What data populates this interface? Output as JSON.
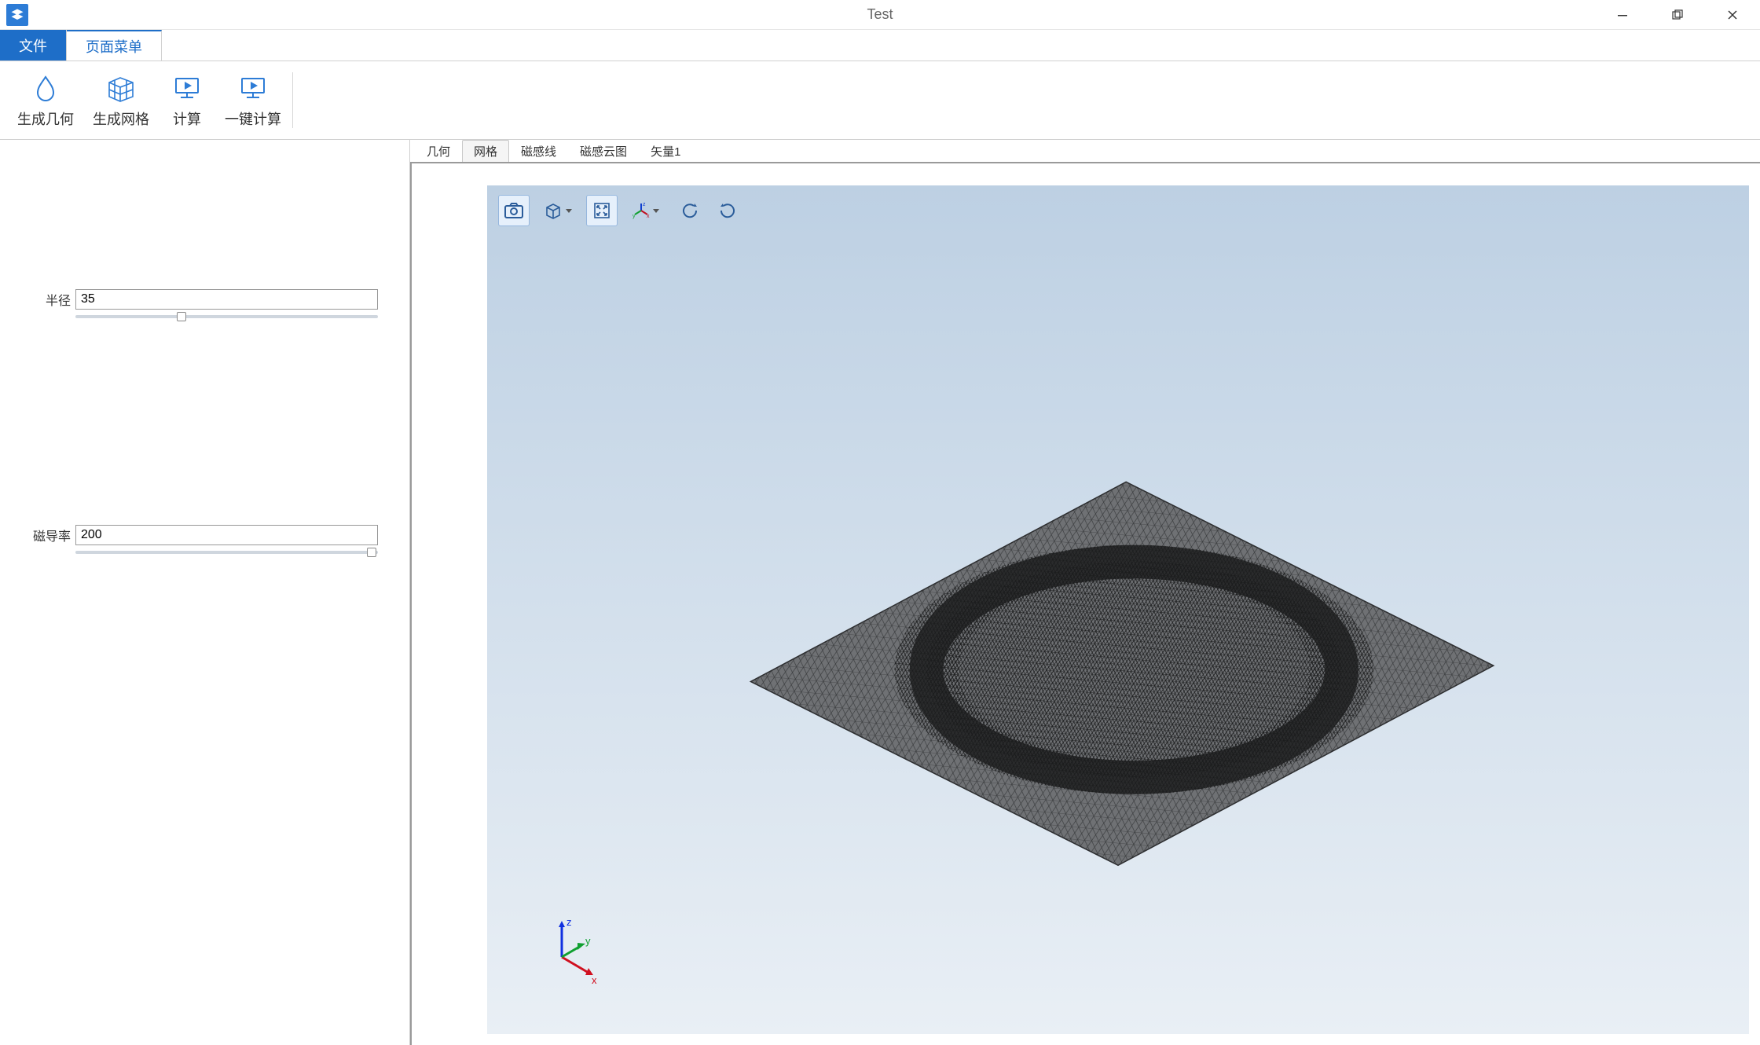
{
  "window": {
    "title": "Test"
  },
  "ribbonTabs": {
    "file": "文件",
    "page": "页面菜单"
  },
  "ribbonButtons": {
    "genGeom": "生成几何",
    "genMesh": "生成网格",
    "compute": "计算",
    "oneClick": "一键计算"
  },
  "params": {
    "radiusLabel": "半径",
    "radiusValue": "35",
    "radiusSliderPct": 35,
    "permLabel": "磁导率",
    "permValue": "200",
    "permSliderPct": 98
  },
  "viewTabs": {
    "geom": "几何",
    "mesh": "网格",
    "fluxLines": "磁感线",
    "fluxCloud": "磁感云图",
    "vector": "矢量1"
  },
  "axisLabels": {
    "x": "x",
    "y": "y",
    "z": "z"
  },
  "colors": {
    "accent": "#1e6ec8",
    "viewportTop": "#bdd0e3",
    "viewportBottom": "#e9eff5",
    "meshFill": "#6f7174"
  }
}
